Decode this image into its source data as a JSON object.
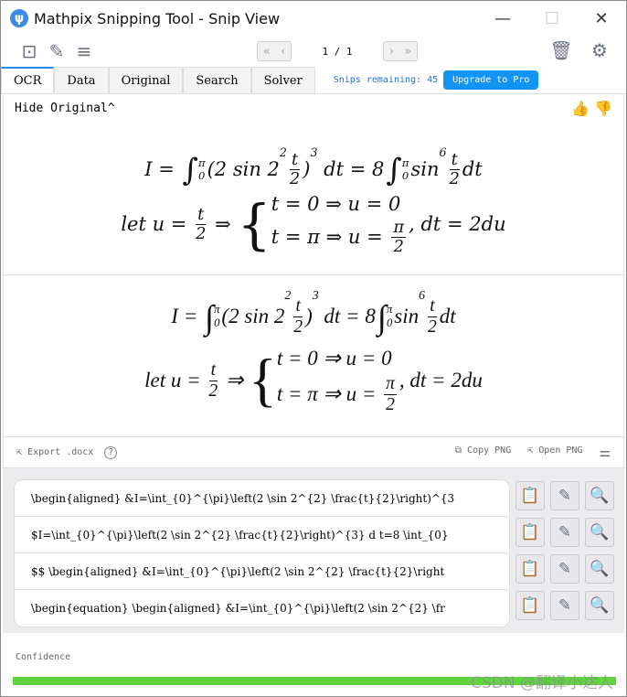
{
  "window": {
    "title": "Mathpix Snipping Tool - Snip View",
    "logo": "ψ",
    "minimize": "—",
    "maximize": "☐",
    "close": "✕"
  },
  "toolbar": {
    "page": "1 / 1",
    "icons": [
      "new-snip-icon",
      "edit-icon",
      "menu-icon"
    ]
  },
  "tabs": [
    {
      "label": "OCR",
      "active": true
    },
    {
      "label": "Data"
    },
    {
      "label": "Original"
    },
    {
      "label": "Search"
    },
    {
      "label": "Solver"
    }
  ],
  "snips_remaining": "Snips remaining: 45",
  "upgrade": "Upgrade to Pro",
  "hide_original": "Hide Original",
  "math": {
    "line1": [
      {
        "t": "text",
        "v": "I = "
      },
      {
        "t": "int",
        "lo": "0",
        "hi": "π"
      },
      {
        "t": "text",
        "v": "(2 sin 2"
      },
      {
        "t": "sup",
        "v": "2"
      },
      {
        "t": "frac",
        "n": "t",
        "d": "2"
      },
      {
        "t": "text",
        "v": ")"
      },
      {
        "t": "sup",
        "v": "3"
      },
      {
        "t": "text",
        "v": " dt = 8"
      },
      {
        "t": "int",
        "lo": "0",
        "hi": "π"
      },
      {
        "t": "text",
        "v": "sin"
      },
      {
        "t": "sup",
        "v": "6"
      },
      {
        "t": "frac",
        "n": "t",
        "d": "2"
      },
      {
        "t": "text",
        "v": "dt"
      }
    ],
    "line2": [
      {
        "t": "text",
        "v": "let u = "
      },
      {
        "t": "frac",
        "n": "t",
        "d": "2"
      },
      {
        "t": "text",
        "v": " ⇒ "
      },
      {
        "t": "cases",
        "rows": [
          [
            {
              "t": "text",
              "v": "t = 0 ⇒ u = 0"
            }
          ],
          [
            {
              "t": "text",
              "v": "t = π ⇒ u = "
            },
            {
              "t": "frac",
              "n": "π",
              "d": "2"
            }
          ]
        ]
      },
      {
        "t": "text",
        "v": ", dt = 2du"
      }
    ]
  },
  "actions": {
    "export": "Export .docx",
    "help": "?",
    "copy_png": "Copy PNG",
    "open_png": "Open PNG"
  },
  "results": [
    "\\begin{aligned} &I=\\int_{0}^{\\pi}\\left(2 \\sin 2^{2} \\frac{t}{2}\\right)^{3",
    "$I=\\int_{0}^{\\pi}\\left(2 \\sin 2^{2} \\frac{t}{2}\\right)^{3} d t=8 \\int_{0}",
    "$$  \\begin{aligned} &I=\\int_{0}^{\\pi}\\left(2 \\sin 2^{2} \\frac{t}{2}\\right",
    "\\begin{equation}  \\begin{aligned} &I=\\int_{0}^{\\pi}\\left(2 \\sin 2^{2} \\fr"
  ],
  "confidence": {
    "label": "Confidence",
    "value": 1.0,
    "color": "#5fd43f"
  },
  "watermark": "CSDN @翻译小达人"
}
